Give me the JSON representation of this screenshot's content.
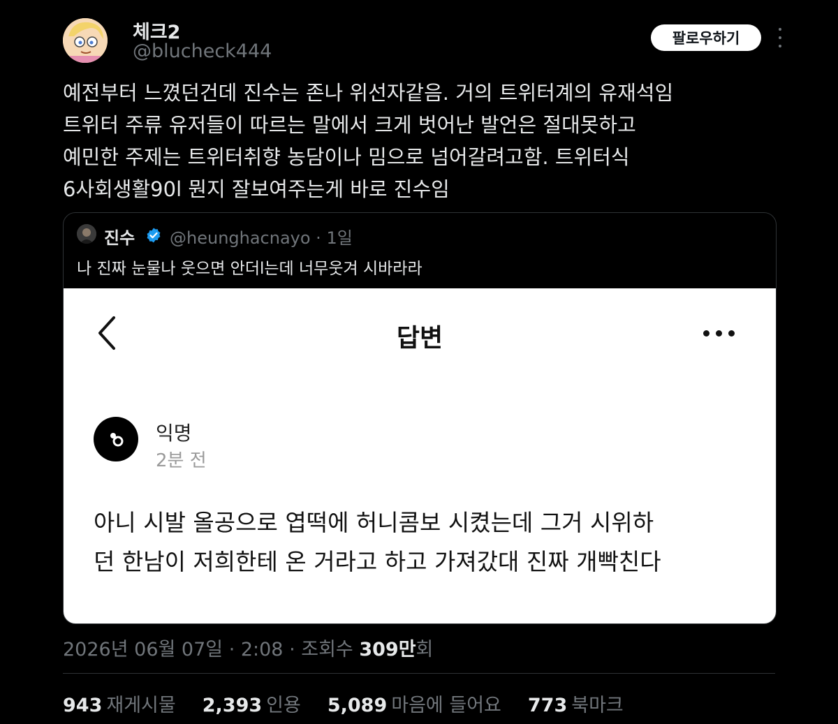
{
  "author": {
    "display_name": "체크2",
    "handle": "@blucheck444"
  },
  "follow_label": "팔로우하기",
  "tweet_lines": [
    "예전부터 느꼈던건데 진수는 존나 위선자같음. 거의 트위터계의 유재석임",
    "트위터 주류 유저들이 따르는 말에서 크게 벗어난 발언은 절대못하고",
    "예민한 주제는 트위터취향 농담이나 밈으로 넘어갈려고함. 트위터식",
    "6사회생활90l 뭔지 잘보여주는게 바로 진수임"
  ],
  "quote": {
    "name": "진수",
    "handle_time": "@heunghacnayo · 1일",
    "text": "나 진짜 눈물나 웃으면 안더l는데 너무웃겨 시바라라",
    "screenshot": {
      "title": "답변",
      "anon_name": "익명",
      "anon_time": "2분 전",
      "answer_lines": [
        "아니 시발 올공으로 엽떡에 허니콤보 시켰는데 그거 시위하",
        "던 한남이 저희한테 온 거라고 하고 가져갔대 진짜 개빡친다"
      ]
    }
  },
  "meta": {
    "datetime": "2026년 06월 07일 · 2:08 · 조회수 ",
    "views_num": "309만",
    "views_suffix": "회"
  },
  "stats": {
    "retweets": "943",
    "retweets_label": "재게시물",
    "quotes": "2,393",
    "quotes_label": "인용",
    "likes": "5,089",
    "likes_label": "마음에 들어요",
    "bookmarks": "773",
    "bookmarks_label": "북마크"
  },
  "colors": {
    "background": "#000000",
    "text_primary": "#e7e9ea",
    "text_secondary": "#71767b",
    "verified": "#1d9bf0"
  }
}
